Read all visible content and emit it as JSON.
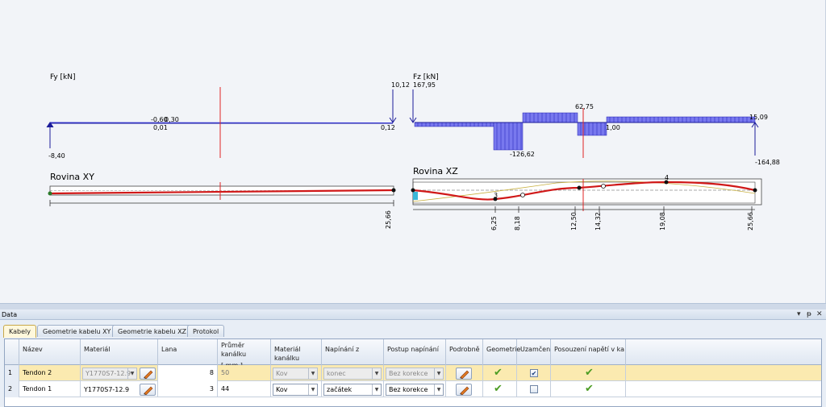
{
  "diagram_fy": {
    "title": "Fy [kN]",
    "labels": {
      "v_left": "-8,40",
      "v_mid_top": "-0,60",
      "v_mid_top2": "0,30",
      "v_mid_bot": "0,01",
      "v_right_top": "10,12",
      "v_right_bot": "0,12"
    }
  },
  "diagram_fz": {
    "title": "Fz [kN]",
    "labels": {
      "v_left_top": "167,95",
      "v_min": "-126,62",
      "v_max": "62,75",
      "v_mid": "1,00",
      "v_right_top": "15,09",
      "v_right_bot": "-164,88"
    }
  },
  "plane_xy": {
    "title": "Rovina XY",
    "dim_right": "25,66"
  },
  "plane_xz": {
    "title": "Rovina XZ",
    "dims": [
      "6,25",
      "8,18",
      "12,50",
      "14,32",
      "19,08",
      "25,66"
    ],
    "point_labels": [
      "3",
      "4"
    ]
  },
  "panel": {
    "title": "Data",
    "controls": {
      "pin": "▾",
      "dock": "ᵽ",
      "close": "✕"
    }
  },
  "tabs": [
    "Kabely",
    "Geometrie kabelu XY",
    "Geometrie kabelu XZ",
    "Protokol"
  ],
  "columns": {
    "name": "Název",
    "material": "Materiál",
    "strands": "Lana",
    "diameter": "Průměr kanálku",
    "diameter_unit": "[ mm ]",
    "duct_material": "Materiál kanálku",
    "stressing_from": "Napínání z",
    "stressing_proc": "Postup napínání",
    "details": "Podrobně",
    "geometry": "Geometrie",
    "locked": "Uzamčen",
    "stress_check": "Posouzení napětí v ka"
  },
  "rows": [
    {
      "index": "1",
      "name": "Tendon 2",
      "material": "Y1770S7-12.9",
      "strands": "8",
      "diameter": "50",
      "duct_material": "Kov",
      "stressing_from": "konec",
      "stressing_proc": "Bez korekce",
      "locked": "✔"
    },
    {
      "index": "2",
      "name": "Tendon 1",
      "material": "Y1770S7-12.9",
      "strands": "3",
      "diameter": "44",
      "duct_material": "Kov",
      "stressing_from": "začátek",
      "stressing_proc": "Bez korekce",
      "locked": ""
    }
  ],
  "colors": {
    "load": "#3a3ad8",
    "cable": "#d01818",
    "section": "#d01818",
    "selected_row": "#fbeab0"
  }
}
